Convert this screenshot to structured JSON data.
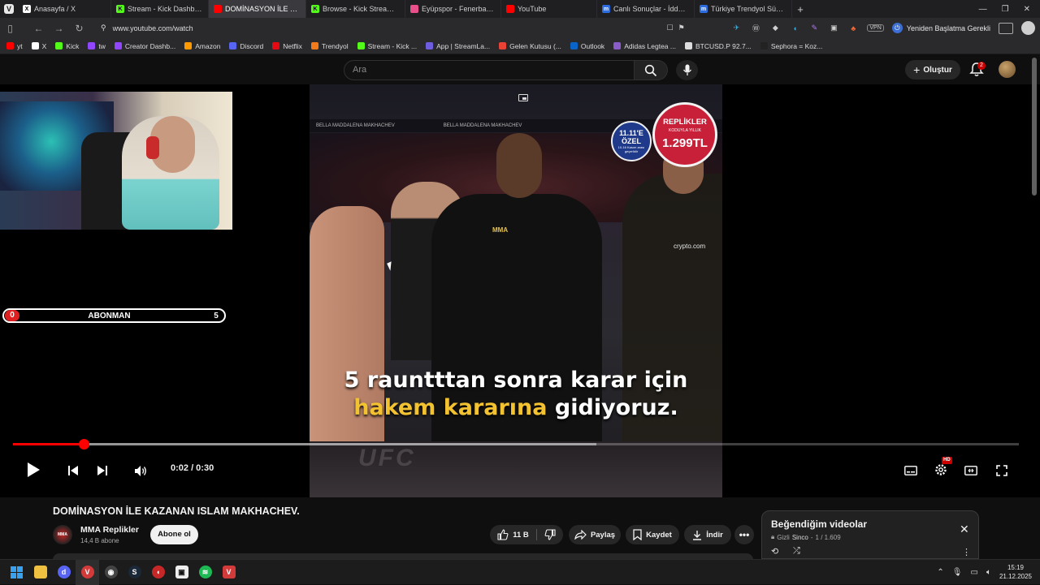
{
  "browser": {
    "tabs": [
      {
        "title": "Anasayfa / X",
        "icon": "x-icon",
        "color": "#ffffff",
        "active": false
      },
      {
        "title": "Stream - Kick Dashboard",
        "icon": "kick-icon",
        "color": "#53fc18",
        "active": false
      },
      {
        "title": "DOMİNASYON İLE KAZANAN ISLAM MAKHACHEV",
        "icon": "youtube-icon",
        "color": "#ff0000",
        "active": true
      },
      {
        "title": "Browse - Kick Streaming",
        "icon": "kick-icon",
        "color": "#53fc18",
        "active": false
      },
      {
        "title": "Eyüpspor - Fenerbahçe Maç",
        "icon": "ball-icon",
        "color": "#e94f8a",
        "active": false
      },
      {
        "title": "YouTube",
        "icon": "youtube-icon",
        "color": "#ff0000",
        "active": false
      },
      {
        "title": "Canlı Sonuçlar - İddaa Sonu",
        "icon": "m-icon",
        "color": "#2d6cdf",
        "active": false
      },
      {
        "title": "Türkiye Trendyol Süper Lig",
        "icon": "m-icon",
        "color": "#2d6cdf",
        "active": false
      }
    ],
    "url": "www.youtube.com/watch",
    "restart_label": "Yeniden Başlatma Gerekli",
    "vpn_label": "VPN",
    "bookmarks": [
      {
        "label": "yt",
        "color": "#ff0000"
      },
      {
        "label": "X",
        "color": "#ffffff"
      },
      {
        "label": "Kick",
        "color": "#53fc18"
      },
      {
        "label": "tw",
        "color": "#9146ff"
      },
      {
        "label": "Creator Dashb...",
        "color": "#9146ff"
      },
      {
        "label": "Amazon",
        "color": "#ff9900"
      },
      {
        "label": "Discord",
        "color": "#5865f2"
      },
      {
        "label": "Netflix",
        "color": "#e50914"
      },
      {
        "label": "Trendyol",
        "color": "#f27a1a"
      },
      {
        "label": "Stream - Kick ...",
        "color": "#53fc18"
      },
      {
        "label": "App | StreamLa...",
        "color": "#6f5de0"
      },
      {
        "label": "Gelen Kutusu (...",
        "color": "#ea4335"
      },
      {
        "label": "Outlook",
        "color": "#0a64c8"
      },
      {
        "label": "Adidas Legtea ...",
        "color": "#8a5cc8"
      },
      {
        "label": "BTCUSD.P 92.7...",
        "color": "#dddddd"
      },
      {
        "label": "Sephora = Koz...",
        "color": "#222222"
      }
    ]
  },
  "youtube": {
    "search_placeholder": "Ara",
    "create_label": "Oluştur",
    "notification_count": "2",
    "video": {
      "caption_line1": "5 rauntttan sonra karar için",
      "caption_hl": "hakem kararına",
      "caption_rest": "gidiyoruz.",
      "promo_blue_top": "11.11'E",
      "promo_blue_mid": "ÖZEL",
      "promo_blue_small": "10-16 Kasım arası geçerlidir",
      "promo_red_title": "REPLİKLER",
      "promo_red_sub": "KODUYLA YILLIK",
      "promo_red_price": "1.299TL",
      "ref_logo": "MMA",
      "fighter_logo": "crypto.com",
      "floor_text": "UFC",
      "banner_text": "BELLA MADDALENA  MAKHACHEV"
    },
    "overlay": {
      "sub_label": "ABONMAN",
      "sub_count_left": "0",
      "sub_count_right": "5"
    },
    "player": {
      "time": "0:02 / 0:30",
      "progress_played": 0.07,
      "progress_buffered": 0.58,
      "hd_badge": "HD"
    },
    "title": "DOMİNASYON İLE KAZANAN ISLAM MAKHACHEV.",
    "channel": {
      "name": "MMA Replikler",
      "subs": "14,4 B abone",
      "avatar_text": "MMA"
    },
    "subscribe_label": "Abone ol",
    "actions": {
      "likes": "11 B",
      "share": "Paylaş",
      "save": "Kaydet",
      "download": "İndir"
    },
    "playlist": {
      "title": "Beğendiğim videolar",
      "privacy": "Gizli",
      "owner": "Sinco",
      "position": "1 / 1.609"
    }
  },
  "taskbar": {
    "time": "15:19",
    "date": "21.12.2025"
  }
}
